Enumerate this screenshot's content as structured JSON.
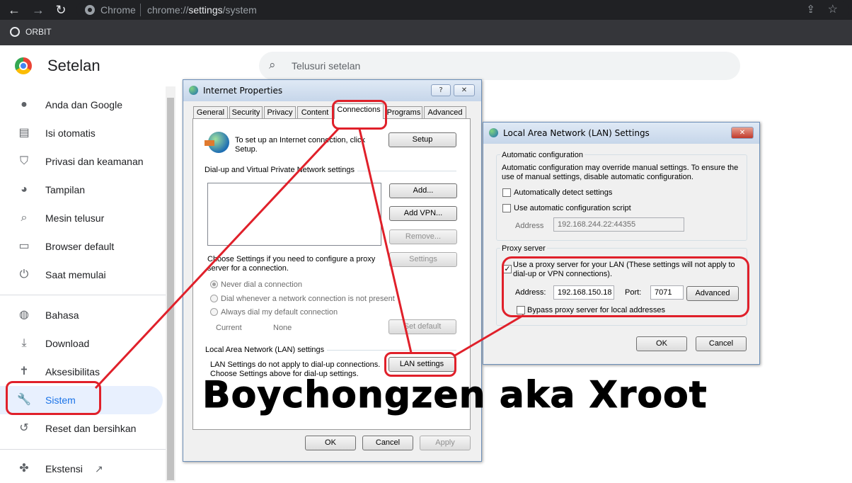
{
  "browser": {
    "site": "Chrome",
    "url_prefix": "chrome://",
    "url_bold": "settings",
    "url_suffix": "/system",
    "bookmark": "ORBIT"
  },
  "settings": {
    "title": "Setelan",
    "search_placeholder": "Telusuri setelan",
    "nav": [
      {
        "label": "Anda dan Google",
        "icon": "person-icon"
      },
      {
        "label": "Isi otomatis",
        "icon": "clipboard-icon"
      },
      {
        "label": "Privasi dan keamanan",
        "icon": "shield-icon"
      },
      {
        "label": "Tampilan",
        "icon": "palette-icon"
      },
      {
        "label": "Mesin telusur",
        "icon": "search-icon"
      },
      {
        "label": "Browser default",
        "icon": "browser-icon"
      },
      {
        "label": "Saat memulai",
        "icon": "power-icon"
      },
      {
        "label": "Bahasa",
        "icon": "globe-icon"
      },
      {
        "label": "Download",
        "icon": "download-icon"
      },
      {
        "label": "Aksesibilitas",
        "icon": "accessibility-icon"
      },
      {
        "label": "Sistem",
        "icon": "wrench-icon"
      },
      {
        "label": "Reset dan bersihkan",
        "icon": "restore-icon"
      },
      {
        "label": "Ekstensi",
        "icon": "puzzle-icon"
      }
    ],
    "active_item": "Sistem"
  },
  "inet": {
    "title": "Internet Properties",
    "help": "?",
    "close": "✕",
    "tabs": [
      "General",
      "Security",
      "Privacy",
      "Content",
      "Connections",
      "Programs",
      "Advanced"
    ],
    "active_tab": "Connections",
    "setup_text": "To set up an Internet connection, click Setup.",
    "setup_btn": "Setup",
    "dialup_heading": "Dial-up and Virtual Private Network settings",
    "add_btn": "Add...",
    "addvpn_btn": "Add VPN...",
    "remove_btn": "Remove...",
    "proxy_text": "Choose Settings if you need to configure a proxy server for a connection.",
    "settings_btn": "Settings",
    "radios": [
      "Never dial a connection",
      "Dial whenever a network connection is not present",
      "Always dial my default connection"
    ],
    "current_label": "Current",
    "current_value": "None",
    "setdefault_btn": "Set default",
    "lan_heading": "Local Area Network (LAN) settings",
    "lan_text": "LAN Settings do not apply to dial-up connections. Choose Settings above for dial-up settings.",
    "lan_btn": "LAN settings",
    "ok": "OK",
    "cancel": "Cancel",
    "apply": "Apply"
  },
  "lan": {
    "title": "Local Area Network (LAN) Settings",
    "close": "✕",
    "auto_heading": "Automatic configuration",
    "auto_text": "Automatic configuration may override manual settings.  To ensure the use of manual settings, disable automatic configuration.",
    "auto_detect": "Automatically detect settings",
    "auto_detect_checked": false,
    "auto_script": "Use automatic configuration script",
    "auto_script_checked": false,
    "address_label": "Address",
    "address_value": "192.168.244.22:44355",
    "proxy_heading": "Proxy server",
    "use_proxy": "Use a proxy server for your LAN (These settings will not apply to dial-up or VPN connections).",
    "use_proxy_checked": true,
    "proxy_address_label": "Address:",
    "proxy_address": "192.168.150.18",
    "port_label": "Port:",
    "port": "7071",
    "advanced_btn": "Advanced",
    "bypass": "Bypass proxy server for local addresses",
    "bypass_checked": false,
    "ok": "OK",
    "cancel": "Cancel"
  },
  "watermark": "Boychongzen aka Xroot",
  "colors": {
    "highlight": "#e0202a",
    "accent": "#1a73e8"
  }
}
